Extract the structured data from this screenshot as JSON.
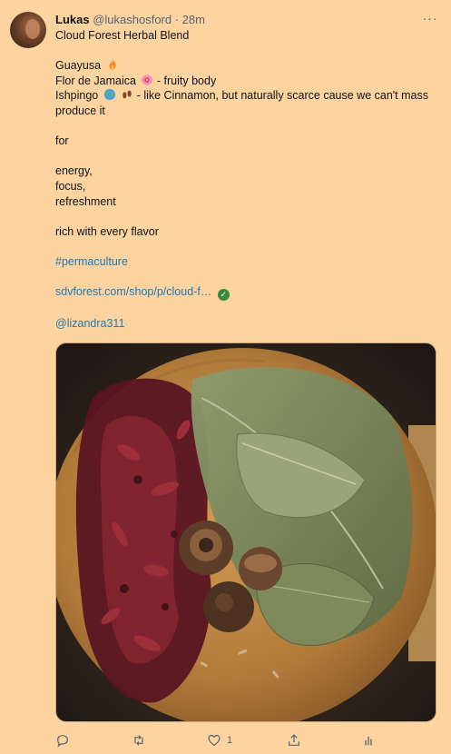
{
  "tweet": {
    "author_name": "Lukas",
    "handle": "@lukashosford",
    "separator": " · ",
    "time": "28m",
    "more_label": "···",
    "lines": {
      "title": "Cloud Forest Herbal Blend",
      "guayusa": "Guayusa",
      "jamaica": "Flor de Jamaica",
      "jamaica_note": " - fruity body",
      "ishpingo": "Ishpingo ",
      "ishpingo_note": " - like Cinnamon, but naturally scarce cause we can't mass produce it",
      "for": "for",
      "energy": "energy,",
      "focus": "focus,",
      "refreshment": "refreshment",
      "rich": "rich with every flavor",
      "hashtag": "#permaculture",
      "link": "sdvforest.com/shop/p/cloud-f…",
      "mention": "@lizandra311"
    },
    "photo_alt": "Dried hibiscus flowers, dried guayusa leaves and ishpingo pods on a round wooden board",
    "actions": {
      "reply_count": "",
      "retweet_count": "",
      "like_count": "1",
      "views_count": ""
    }
  }
}
